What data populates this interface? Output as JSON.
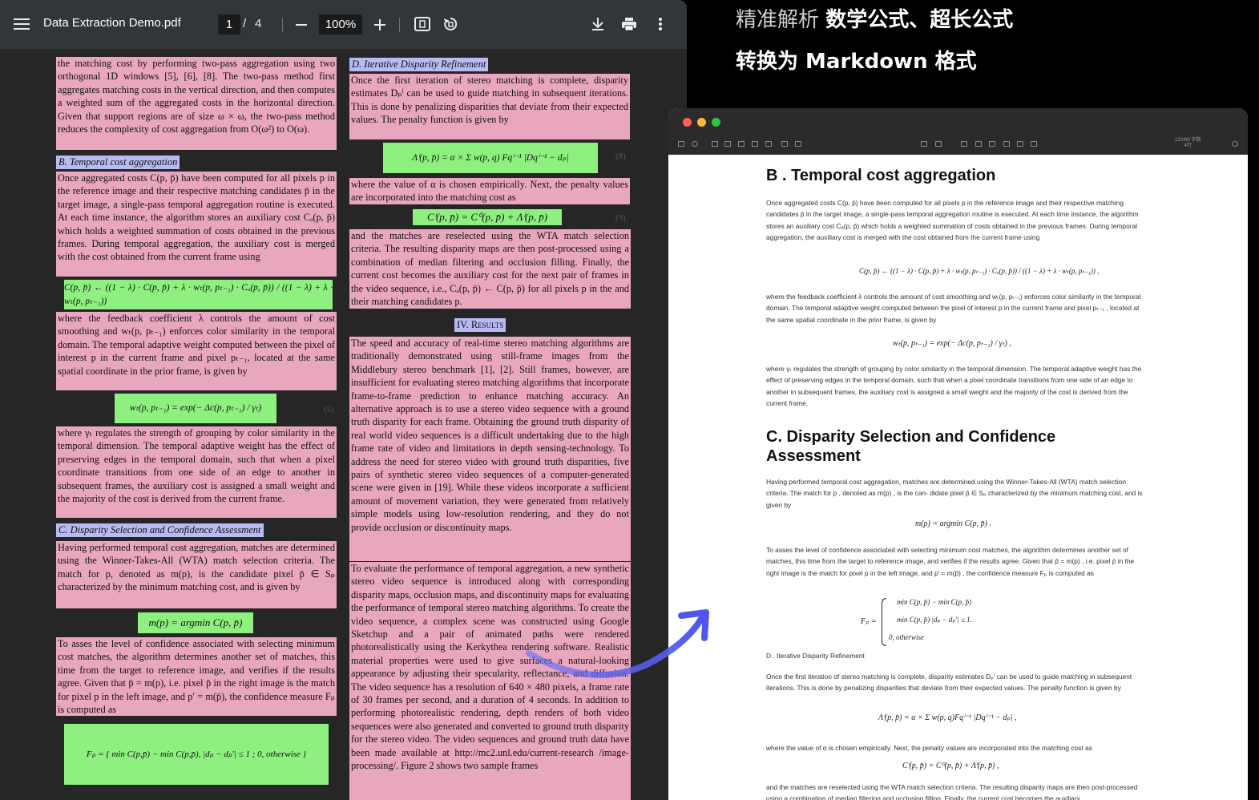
{
  "viewer": {
    "doc_title": "Data Extraction Demo.pdf",
    "current_page": "1",
    "page_separator": "/",
    "page_total": "4",
    "zoom": "100%"
  },
  "left_col": {
    "p1": "the matching cost by performing two-pass aggregation using two orthogonal 1D windows [5], [6], [8]. The two-pass method first aggregates matching costs in the vertical direction, and then computes a weighted sum of the aggregated costs in the horizontal direction. Given that support regions are of size ω × ω, the two-pass method reduces the complexity of cost aggregation from O(ω²) to O(ω).",
    "sec_b": "B. Temporal cost aggregation",
    "p2": "Once aggregated costs C(p, p̄) have been computed for all pixels p in the reference image and their respective matching candidates p̄ in the target image, a single-pass temporal aggregation routine is executed. At each time instance, the algorithm stores an auxiliary cost Cₐ(p, p̄) which holds a weighted summation of costs obtained in the previous frames. During temporal aggregation, the auxiliary cost is merged with the cost obtained from the current frame using",
    "eq4": "C(p, p̄) ← ((1 − λ) · C(p, p̄) + λ · wₜ(p, pₜ₋₁) · Cₐ(p, p̄)) / ((1 − λ) + λ · wₜ(p, pₜ₋₁))",
    "p3": "where the feedback coefficient λ controls the amount of cost smoothing and wₜ(p, pₜ₋₁) enforces color similarity in the temporal domain. The temporal adaptive weight computed between the pixel of interest p in the current frame and pixel pₜ₋₁, located at the same spatial coordinate in the prior frame, is given by",
    "eq5": "wₜ(p, pₜ₋₁) = exp(− Δc(p, pₜ₋₁) / γₜ)",
    "eq5_num": "(5)",
    "p4": "where γₜ regulates the strength of grouping by color similarity in the temporal dimension. The temporal adaptive weight has the effect of preserving edges in the temporal domain, such that when a pixel coordinate transitions from one side of an edge to another in subsequent frames, the auxiliary cost is assigned a small weight and the majority of the cost is derived from the current frame.",
    "sec_c": "C. Disparity Selection and Confidence Assessment",
    "p5": "Having performed temporal cost aggregation, matches are determined using the Winner-Takes-All (WTA) match selection criteria. The match for p, denoted as m(p), is the candidate pixel p̄ ∈ Sₚ characterized by the minimum matching cost, and is given by",
    "eq6": "m(p) = argmin C(p, p̄)",
    "p6": "To asses the level of confidence associated with selecting minimum cost matches, the algorithm determines another set of matches, this time from the target to reference image, and verifies if the results agree. Given that p̄ = m(p), i.e. pixel p̄ in the right image is the match for pixel p in the left image, and p′ = m(p̄), the confidence measure Fₚ is computed as",
    "eq7": "Fₚ = { min C(p,p̄) − min C(p,p̄),  |dₚ − dₚ′| ≤ 1 ;  0, otherwise }"
  },
  "right_col": {
    "sec_d": "D. Iterative Disparity Refinement",
    "p1": "Once the first iteration of stereo matching is complete, disparity estimates Dₚⁱ can be used to guide matching in subsequent iterations. This is done by penalizing disparities that deviate from their expected values. The penalty function is given by",
    "eq8": "Λⁱ(p, p̄) = α × Σ w(p, q) Fqⁱ⁻¹ |Dqⁱ⁻¹ − dₚ|",
    "eq8_num": "(8)",
    "p2": "where the value of α is chosen empirically. Next, the penalty values are incorporated into the matching cost as",
    "eq9": "Cⁱ(p, p̄) = C⁰(p, p̄) + Λⁱ(p, p̄)",
    "eq9_num": "(9)",
    "p3": "and the matches are reselected using the WTA match selection criteria. The resulting disparity maps are then post-processed using a combination of median filtering and occlusion filling. Finally, the current cost becomes the auxiliary cost for the next pair of frames in the video sequence, i.e., Cₐ(p, p̄) ← C(p, p̄) for all pixels p in the and their matching candidates p.",
    "sec_iv": "IV. Results",
    "p4": "The speed and accuracy of real-time stereo matching algorithms are traditionally demonstrated using still-frame images from the Middlebury stereo benchmark [1], [2]. Still frames, however, are insufficient for evaluating stereo matching algorithms that incorporate frame-to-frame prediction to enhance matching accuracy. An alternative approach is to use a stereo video sequence with a ground truth disparity for each frame. Obtaining the ground truth disparity of real world video sequences is a difficult undertaking due to the high frame rate of video and limitations in depth sensing-technology. To address the need for stereo video with ground truth disparities, five pairs of synthetic stereo video sequences of a computer-generated scene were given in [19]. While these videos incorporate a sufficient amount of movement variation, they were generated from relatively simple models using low-resolution rendering, and they do not provide occlusion or discontinuity maps.",
    "p5": "To evaluate the performance of temporal aggregation, a new synthetic stereo video sequence is introduced along with corresponding disparity maps, occlusion maps, and discontinuity maps for evaluating the performance of temporal stereo matching algorithms. To create the video sequence, a complex scene was constructed using Google Sketchup and a pair of animated paths were rendered photorealistically using the Kerkythea rendering software. Realistic material properties were used to give surfaces a natural-looking appearance by adjusting their specularity, reflectance, and diffusion. The video sequence has a resolution of 640 × 480 pixels, a frame rate of 30 frames per second, and a duration of 4 seconds. In addition to performing photorealistic rendering, depth renders of both video sequences were also generated and converted to ground truth disparity for the stereo video. The video sequences and ground truth data have been made available at http://mc2.unl.edu/current-research /image-processing/. Figure 2 shows two sample frames"
  },
  "captions": {
    "line1_light": "精准解析",
    "line1_bold": "数学公式、超长公式",
    "line2_bold": "转换为 Markdown 格式"
  },
  "md_window": {
    "meta_line1": "1224W 字数",
    "meta_line2": "4行",
    "h2_b": "B . Temporal cost aggregation",
    "p_b": "Once aggregated costs C(p, p̄) have been computed for all pixels p in the reference image and their respective matching candidates p̄ in the target image, a single-pass temporal aggregation routine is executed. At each time instance, the algorithm stores an auxiliary cost Cₐ(p, p̄) which holds a weighted summation of costs obtained in the previous frames. During temporal aggregation, the auxiliary cost is merged with the cost obtained from the current frame using",
    "eq_b": "C(p, p̄) ← ((1 − λ) · C(p, p̄) + λ · wₜ(p, pₜ₋₁) · Cₐ(p, p̄)) / ((1 − λ) + λ · wₜ(p, pₜ₋₁)) ,",
    "p_b2": "where the feedback coefficient λ controls the amount of cost smoothing and wₜ(p, pₜ₋₁) enforces color similarity in the temporal domain. The temporal adaptive weight computed between the pixel of interest p in the current frame and pixel pₜ₋₁ , located at the same spatial coordinate in the prior frame, is given by",
    "eq_b2": "wₜ(p, pₜ₋₁) = exp(− Δc(p, pₜ₋₁) / γₜ) ,",
    "p_b3": "where γₜ regulates the strength of grouping by color similarity in the temporal dimension. The temporal adaptive weight has the effect of preserving edges in the temporal domain, such that when a pixel coordinate transitions from one side of an edge to another in subsequent frames, the auxiliary cost is assigned a small weight and the majority of the cost is derived from the current frame.",
    "h2_c": "C. Disparity Selection and Confidence Assessment",
    "p_c": "Having performed temporal cost aggregation, matches are determined using the Winner-Takes-All (WTA) match selection criteria. The match for p , denoted as m(p) , is the can- didate pixel p̄ ∈ Sₚ characterized by the minimum matching cost, and is given by",
    "eq_c": "m(p) = argmin C(p, p̄) .",
    "p_c2": "To asses the level of confidence associated with selecting minimum cost matches, the algorithm determines another set of matches, this time from the target to reference image, and verifies if the results agree. Given that p̄ = m(p) , i.e. pixel p̄ in the right image is the match for pixel p in the left image, and p′ = m(p̄) , the confidence measure Fₚ is computed as",
    "eq_c2a": "min C(p, p̄) − min C(p, p̄)",
    "eq_c2b": "min C(p, p̄)                    |dₚ − dₚ′| ≤ 1.",
    "eq_c2c": "0,                                    otherwise",
    "eq_c2_lhs": "Fₚ =",
    "h3_d": "D . Iterative Disparity Refinement",
    "p_d": "Once the first iteration of stereo matching is complete, disparity estimates Dₚⁱ can be used to guide matching in subsequent iterations. This is done by penalizing disparities that deviate from their expected values. The penalty function is given by",
    "eq_d": "Λⁱ(p, p̄) = α × Σ w(p, q)Fqⁱ⁻¹ |Dqⁱ⁻¹ − dₚ| ,",
    "p_d2": "where the value of α is chosen empirically. Next, the penalty values are incorporated into the matching cost as",
    "eq_d2": "Cⁱ(p, p̄) = C⁰(p, p̄) + Λⁱ(p, p̄) ,",
    "p_d3": "and the matches are reselected using the WTA match selection criteria. The resulting disparity maps are then post-processed using a combination of median filtering and occlusion filling. Finally, the current cost becomes the auxiliary"
  }
}
